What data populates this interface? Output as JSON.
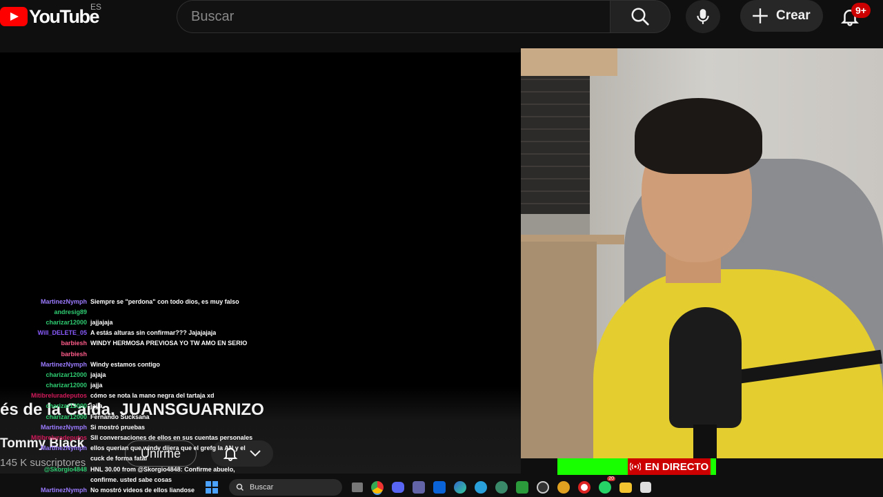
{
  "header": {
    "logo_text": "YouTube",
    "country_code": "ES",
    "search_placeholder": "Buscar",
    "create_label": "Crear",
    "notification_count": "9+"
  },
  "video": {
    "title": "és de la Caída. JUANSGUARNIZO",
    "channel_name": "Tommy Black",
    "subscribers": "145 K suscriptores",
    "join_label": "Unirme",
    "live_label": "EN DIRECTO"
  },
  "chat": [
    {
      "user": "MartinezNymph",
      "color": "#9b7bff",
      "message": "Siempre se \"perdona\" con todo dios, es muy falso"
    },
    {
      "user": "andresig89",
      "color": "#2ecc71",
      "message": ""
    },
    {
      "user": "charizar12000",
      "color": "#2ecc71",
      "message": "jajjajaja"
    },
    {
      "user": "Will_DELETE_05",
      "color": "#8a5cff",
      "message": "A estás alturas sin confirmar??? Jajajajaja"
    },
    {
      "user": "barbiesh",
      "color": "#ff5c8a",
      "message": "WINDY HERMOSA PREVIOSA YO TW AMO EN SERIO"
    },
    {
      "user": "barbiesh",
      "color": "#ff5c8a",
      "message": ""
    },
    {
      "user": "MartinezNymph",
      "color": "#9b7bff",
      "message": "Windy estamos contigo"
    },
    {
      "user": "charizar12000",
      "color": "#2ecc71",
      "message": "jajaja"
    },
    {
      "user": "charizar12000",
      "color": "#2ecc71",
      "message": "jajja"
    },
    {
      "user": "Mitibreluradeputos",
      "color": "#d11a5a",
      "message": "cómo se nota la mano negra del tartaja xd"
    },
    {
      "user": "charizar12000",
      "color": "#2ecc71",
      "message": "jajja"
    },
    {
      "user": "charizar12000",
      "color": "#2ecc71",
      "message": "Fernando Sucksana"
    },
    {
      "user": "MartinezNymph",
      "color": "#9b7bff",
      "message": "Si mostró pruebas"
    },
    {
      "user": "Mitibreluradeputos",
      "color": "#d11a5a",
      "message": "SII conversaciones de ellos en sus cuentas personales"
    },
    {
      "user": "MartinezNymph",
      "color": "#9b7bff",
      "message": "ellos querian que windy dijera que el grefg la AN y el"
    },
    {
      "user": "",
      "color": "#ffffff",
      "message": "cuck de forma fatal"
    },
    {
      "user": "@Skorgio4848",
      "color": "#2ecc71",
      "message": "HNL 30.00 from @Skorgio4848: Confirme abuelo,"
    },
    {
      "user": "",
      "color": "#ffffff",
      "message": "confirme. usted sabe cosas"
    },
    {
      "user": "MartinezNymph",
      "color": "#9b7bff",
      "message": "No mostró videos de ellos liandose"
    }
  ],
  "taskbar": {
    "search_label": "Buscar",
    "discord_badge": "20"
  },
  "icons": {
    "search": "search-icon",
    "mic": "microphone-icon",
    "create": "plus-icon",
    "bell": "bell-icon",
    "live": "broadcast-icon"
  },
  "colors": {
    "youtube_red": "#ff0000",
    "live_red": "#cc0000",
    "green_strip": "#18ff00"
  }
}
